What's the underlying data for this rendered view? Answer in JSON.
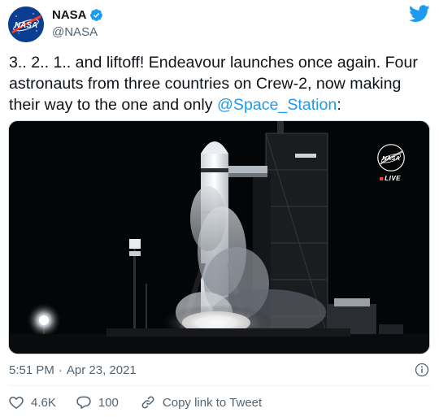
{
  "author": {
    "display_name": "NASA",
    "handle": "@NASA",
    "avatar_text": "NASA",
    "verified": true
  },
  "tweet": {
    "text": "3.. 2.. 1.. and liftoff! Endeavour launches once again. Four astronauts from three countries on Crew-2, now making their way to the one and only ",
    "mention": "@Space_Station",
    "text_tail": ":"
  },
  "media": {
    "logo_text": "NASA",
    "live_label": "LIVE"
  },
  "meta": {
    "time": "5:51 PM",
    "separator": "·",
    "date": "Apr 23, 2021"
  },
  "actions": {
    "like_count": "4.6K",
    "reply_count": "100",
    "copy_link_label": "Copy link to Tweet"
  },
  "colors": {
    "link": "#1d9bf0",
    "secondary_text": "#536471",
    "nasa_blue": "#0b3d91",
    "nasa_red": "#fc3d21"
  }
}
